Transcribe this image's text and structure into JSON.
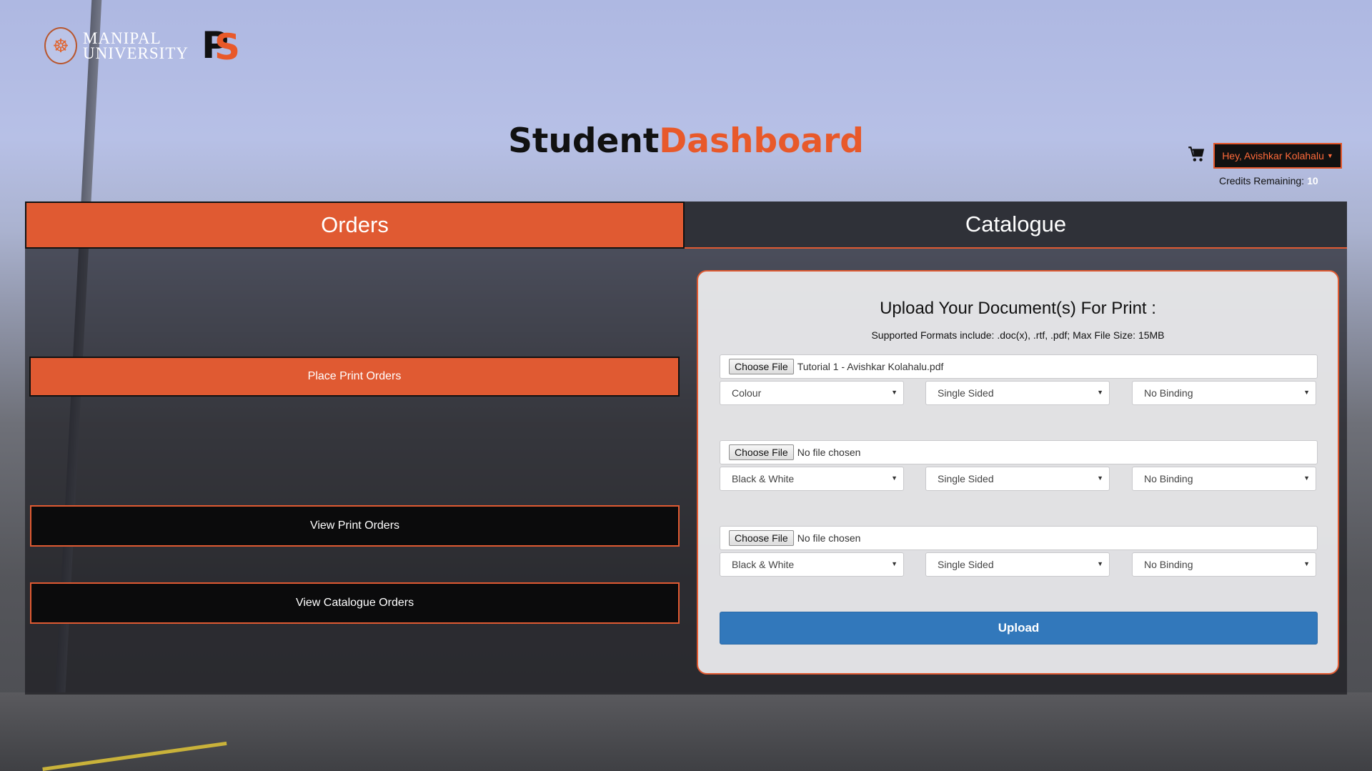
{
  "header": {
    "logo_university": "MANIPAL UNIVERSITY",
    "logo_ps": "PS",
    "title_part1": "Student",
    "title_part2": "Dashboard",
    "user_menu_label": "Hey, Avishkar Kolahalu",
    "credits_label": "Credits Remaining:",
    "credits_value": "10"
  },
  "tabs": [
    {
      "label": "Orders",
      "active": true
    },
    {
      "label": "Catalogue",
      "active": false
    }
  ],
  "left_actions": {
    "place": "Place Print Orders",
    "view_print": "View Print Orders",
    "view_catalogue": "View Catalogue Orders"
  },
  "upload": {
    "title": "Upload Your Document(s) For Print :",
    "subtitle": "Supported Formats include: .doc(x), .rtf, .pdf; Max File Size: 15MB",
    "choose_label": "Choose File",
    "rows": [
      {
        "file": "Tutorial 1 - Avishkar Kolahalu.pdf",
        "color": "Colour",
        "sides": "Single Sided",
        "binding": "No Binding"
      },
      {
        "file": "No file chosen",
        "color": "Black & White",
        "sides": "Single Sided",
        "binding": "No Binding"
      },
      {
        "file": "No file chosen",
        "color": "Black & White",
        "sides": "Single Sided",
        "binding": "No Binding"
      }
    ],
    "button_label": "Upload"
  },
  "colors": {
    "accent": "#e05a32",
    "primary_button": "#3278bb",
    "panel_dark": "#2f3138"
  },
  "icons": [
    "cart-icon",
    "caret-down-icon",
    "university-crest-icon"
  ]
}
